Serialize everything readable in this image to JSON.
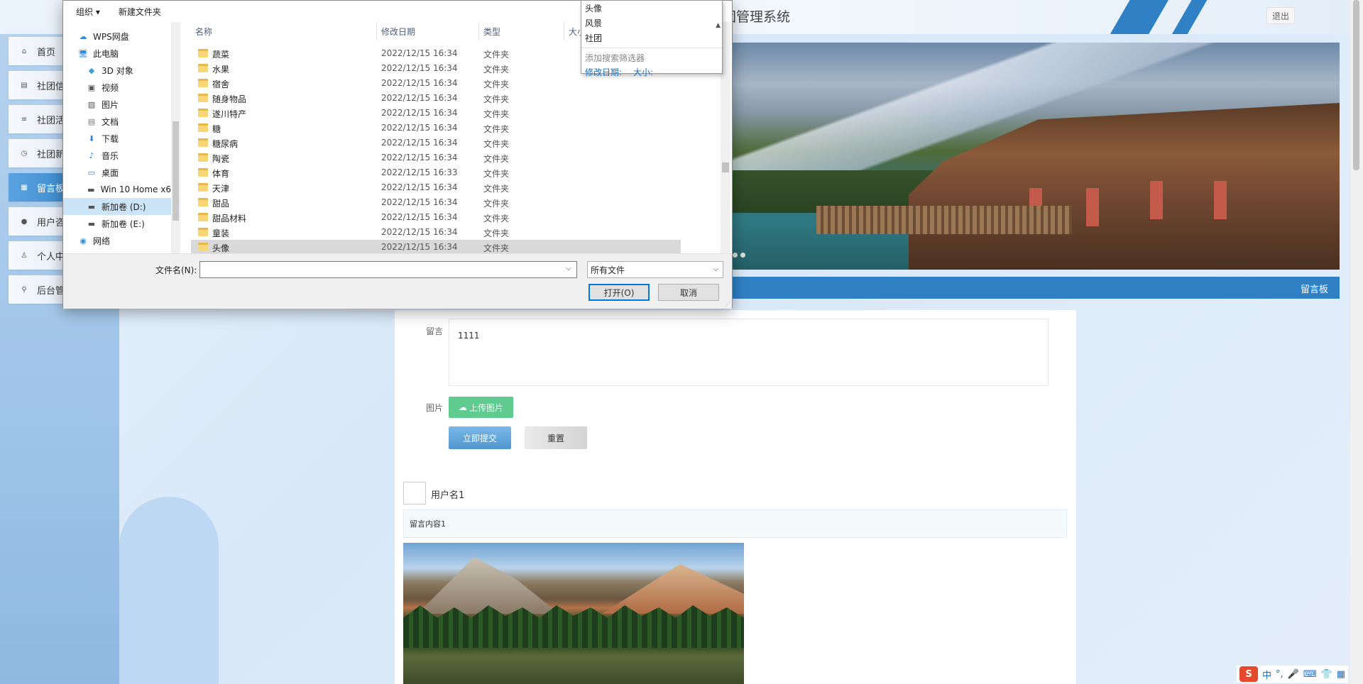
{
  "site": {
    "title": "团管理系统",
    "logout": "退出"
  },
  "sidenav": [
    {
      "label": "首页",
      "icon": "home-icon"
    },
    {
      "label": "社团信",
      "icon": "table-icon"
    },
    {
      "label": "社团活",
      "icon": "sliders-icon"
    },
    {
      "label": "社团新",
      "icon": "clock-icon"
    },
    {
      "label": "留言板",
      "icon": "grid-icon",
      "active": true
    },
    {
      "label": "用户咨",
      "icon": "circle-icon"
    },
    {
      "label": "个人中心",
      "icon": "user-icon"
    },
    {
      "label": "后台管",
      "icon": "link-icon"
    }
  ],
  "section": {
    "label": "留言板"
  },
  "form": {
    "message_label": "留言",
    "message_value": "1111",
    "image_label": "图片",
    "upload_label": "上传图片",
    "submit_label": "立即提交",
    "reset_label": "重置"
  },
  "comment": {
    "username": "用户名1",
    "content": "留言内容1"
  },
  "dialog": {
    "toolbar": {
      "organize": "组织 ▾",
      "new_folder": "新建文件夹"
    },
    "nav": [
      {
        "label": "WPS网盘",
        "icon": "cloud-icon",
        "color": "#2d8ce0",
        "indent": 20
      },
      {
        "label": "此电脑",
        "icon": "computer-icon",
        "color": "#2d8ce0",
        "indent": 20
      },
      {
        "label": "3D 对象",
        "icon": "cube-icon",
        "color": "#3aa0d8",
        "indent": 32
      },
      {
        "label": "视频",
        "icon": "video-icon",
        "color": "#555555",
        "indent": 32
      },
      {
        "label": "图片",
        "icon": "picture-icon",
        "color": "#555555",
        "indent": 32
      },
      {
        "label": "文档",
        "icon": "document-icon",
        "color": "#777777",
        "indent": 32
      },
      {
        "label": "下载",
        "icon": "download-icon",
        "color": "#2d7fd8",
        "indent": 32
      },
      {
        "label": "音乐",
        "icon": "music-icon",
        "color": "#2d7fd8",
        "indent": 32
      },
      {
        "label": "桌面",
        "icon": "desktop-icon",
        "color": "#2d7fd8",
        "indent": 32
      },
      {
        "label": "Win 10 Home x6",
        "icon": "drive-icon",
        "color": "#555555",
        "indent": 32
      },
      {
        "label": "新加卷 (D:)",
        "icon": "drive-icon",
        "color": "#555555",
        "indent": 32,
        "selected": true
      },
      {
        "label": "新加卷 (E:)",
        "icon": "drive-icon",
        "color": "#555555",
        "indent": 32
      },
      {
        "label": "网络",
        "icon": "network-icon",
        "color": "#2d8ce0",
        "indent": 20
      }
    ],
    "columns": {
      "name": "名称",
      "date": "修改日期",
      "type": "类型",
      "size": "大小"
    },
    "files": [
      {
        "name": "蔬菜",
        "date": "2022/12/15 16:34",
        "type": "文件夹"
      },
      {
        "name": "水果",
        "date": "2022/12/15 16:34",
        "type": "文件夹"
      },
      {
        "name": "宿舍",
        "date": "2022/12/15 16:34",
        "type": "文件夹"
      },
      {
        "name": "随身物品",
        "date": "2022/12/15 16:34",
        "type": "文件夹"
      },
      {
        "name": "遂川特产",
        "date": "2022/12/15 16:34",
        "type": "文件夹"
      },
      {
        "name": "糖",
        "date": "2022/12/15 16:34",
        "type": "文件夹"
      },
      {
        "name": "糖尿病",
        "date": "2022/12/15 16:34",
        "type": "文件夹"
      },
      {
        "name": "陶瓷",
        "date": "2022/12/15 16:34",
        "type": "文件夹"
      },
      {
        "name": "体育",
        "date": "2022/12/15 16:33",
        "type": "文件夹"
      },
      {
        "name": "天津",
        "date": "2022/12/15 16:34",
        "type": "文件夹"
      },
      {
        "name": "甜品",
        "date": "2022/12/15 16:34",
        "type": "文件夹"
      },
      {
        "name": "甜品材料",
        "date": "2022/12/15 16:34",
        "type": "文件夹"
      },
      {
        "name": "童装",
        "date": "2022/12/15 16:34",
        "type": "文件夹"
      },
      {
        "name": "头像",
        "date": "2022/12/15 16:34",
        "type": "文件夹",
        "selected": true
      }
    ],
    "search_dropdown": {
      "items": [
        "头像",
        "风景",
        "社团"
      ],
      "hint": "添加搜索筛选器",
      "filter_date": "修改日期:",
      "filter_size": "大小:"
    },
    "filename_label": "文件名(N):",
    "filename_value": "",
    "filetype": "所有文件",
    "open": "打开(O)",
    "cancel": "取消"
  },
  "ime": {
    "logo": "S",
    "items": [
      "中",
      "°,",
      "🎤",
      "⌨",
      "👕",
      "▦"
    ]
  },
  "colors": {
    "accent": "#2f80c4",
    "upload": "#5fcb8f",
    "selection": "#cce4f7"
  }
}
